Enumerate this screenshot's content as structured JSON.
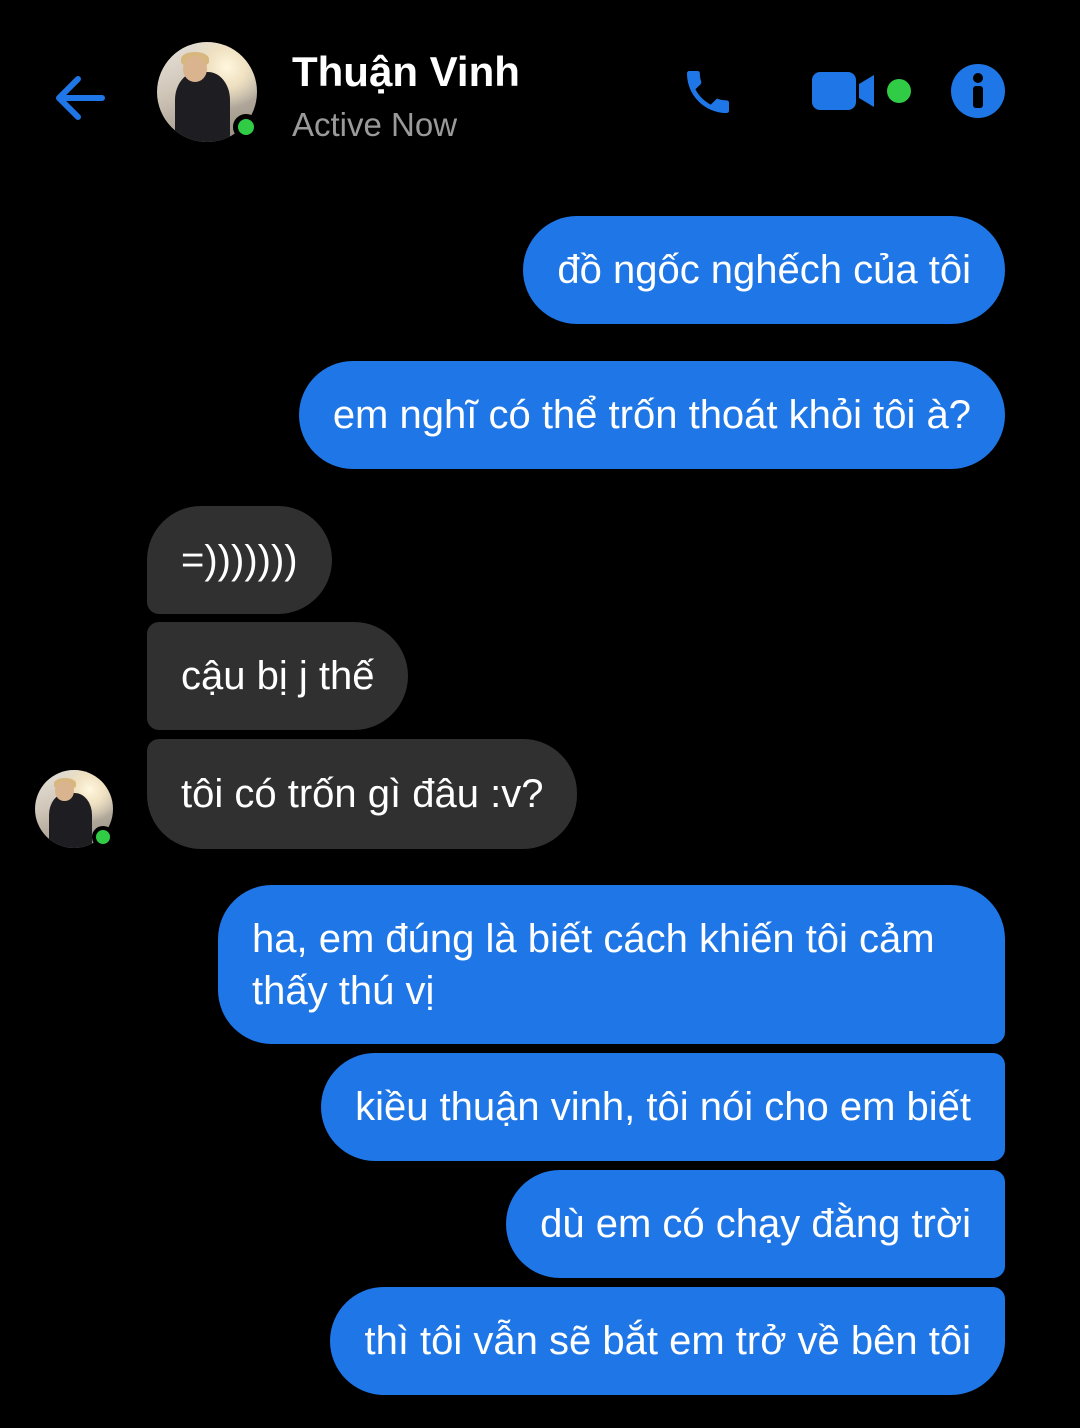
{
  "header": {
    "contact_name": "Thuận Vinh",
    "status": "Active Now",
    "icons": {
      "back": "back-arrow-icon",
      "call": "phone-icon",
      "video": "video-camera-icon",
      "info": "info-icon"
    }
  },
  "colors": {
    "accent": "#1f76e6",
    "sent_bubble": "#1f76e6",
    "received_bubble": "#303030",
    "online": "#31cc46",
    "background": "#000000"
  },
  "messages": [
    {
      "direction": "sent",
      "text": "đồ ngốc nghếch của tôi"
    },
    {
      "direction": "sent",
      "text": "em nghĩ có thể trốn thoát khỏi tôi à?"
    },
    {
      "direction": "received",
      "text": "=)))))))"
    },
    {
      "direction": "received",
      "text": "cậu bị j thế"
    },
    {
      "direction": "received",
      "text": "tôi có trốn gì đâu :v?"
    },
    {
      "direction": "sent",
      "text": "ha, em đúng là biết cách khiến tôi cảm thấy thú vị"
    },
    {
      "direction": "sent",
      "text": "kiều thuận vinh, tôi nói cho em biết"
    },
    {
      "direction": "sent",
      "text": "dù em có chạy đằng trời"
    },
    {
      "direction": "sent",
      "text": "thì tôi vẫn sẽ bắt em trở về bên tôi"
    }
  ]
}
